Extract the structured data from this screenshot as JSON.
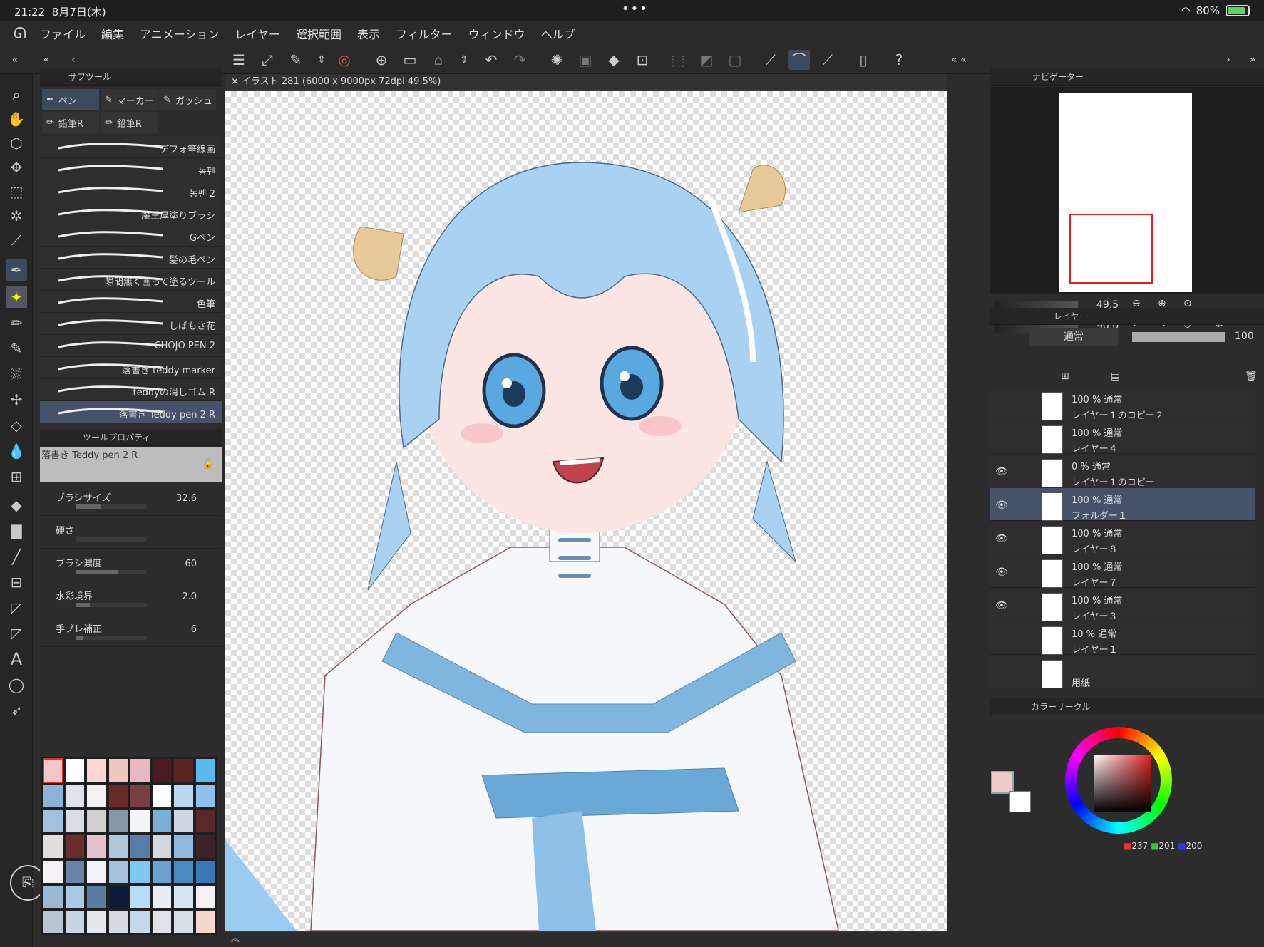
{
  "status": {
    "time": "21:22",
    "date": "8月7日(木)",
    "dots": "•••",
    "battery": "80%"
  },
  "menu": [
    "ファイル",
    "編集",
    "アニメーション",
    "レイヤー",
    "選択範囲",
    "表示",
    "フィルター",
    "ウィンドウ",
    "ヘルプ"
  ],
  "subtool": {
    "header": "サブツール",
    "tabs": [
      {
        "label": "ペン",
        "active": true
      },
      {
        "label": "マーカー",
        "active": false
      },
      {
        "label": "ガッシュ",
        "active": false
      },
      {
        "label": "鉛筆R",
        "active": false
      },
      {
        "label": "鉛筆R",
        "active": false
      }
    ],
    "brushes": [
      "デフォ筆線画",
      "농펜",
      "농펜 2",
      "魔王厚塗りブラシ",
      "Gペン",
      "髪の毛ペン",
      "隙間無く囲って塗るツール",
      "色筆",
      "しばもさ花",
      "CHOJO PEN 2",
      "落書き teddy marker",
      "teddyの消しゴム R",
      "落書き Teddy pen 2 R"
    ],
    "active_index": 12
  },
  "toolprop": {
    "header": "ツールプロパティ",
    "brush_name": "落書き Teddy pen 2 R",
    "rows": [
      {
        "label": "ブラシサイズ",
        "value": "32.6",
        "fill": 0.35
      },
      {
        "label": "硬さ",
        "value": "",
        "fill": 0
      },
      {
        "label": "ブラシ濃度",
        "value": "60",
        "fill": 0.6
      },
      {
        "label": "水彩境界",
        "value": "2.0",
        "fill": 0.2
      },
      {
        "label": "手ブレ補正",
        "value": "6",
        "fill": 0.1
      }
    ]
  },
  "palette": [
    "#f4c6c8",
    "#ffffff",
    "#fbd6d2",
    "#f0c4c0",
    "#e7b7c2",
    "#4a1c22",
    "#5a2420",
    "#5ab8f0",
    "#8db4d8",
    "#e0e4ea",
    "#f2f0f0",
    "#6a2a2a",
    "#7a4040",
    "#ffffff",
    "#bcd8f0",
    "#8ec0ec",
    "#9ec2e0",
    "#d8dce4",
    "#cfcfcf",
    "#8898a8",
    "#f2f4f6",
    "#7ab0d8",
    "#cfd8e2",
    "#5a2828",
    "#e0dce0",
    "#6a3030",
    "#e4c0cc",
    "#b0c8dc",
    "#5a7ea8",
    "#d0d8e0",
    "#8fb8dc",
    "#3a2428",
    "#f4f2f4",
    "#6a84a8",
    "#f0f2f6",
    "#a0c0dc",
    "#7ec8f0",
    "#6ca0d0",
    "#4a88c0",
    "#3a78b8",
    "#9ab8d4",
    "#a8c8e4",
    "#5c7ca0",
    "#0c1c38",
    "#b8dcf8",
    "#e8eef4",
    "#d4e4f0",
    "#f4f0f4",
    "#b8c4d0",
    "#c8d4e0",
    "#e4e8ec",
    "#d4dae0",
    "#c4d8ea",
    "#e0e4ea",
    "#d6dee6",
    "#f8d6d0"
  ],
  "document": {
    "title": "イラスト 281 (6000 x 9000px 72dpi 49.5%)"
  },
  "navigator": {
    "header": "ナビゲーター",
    "zoom": "49.5",
    "rotate": "90.0"
  },
  "layers": {
    "header": "レイヤー",
    "blend": "通常",
    "opacity": "100",
    "items": [
      {
        "pct": "100 % 通常",
        "name": "レイヤー１のコピー２",
        "visible": false,
        "active": false
      },
      {
        "pct": "100 % 通常",
        "name": "レイヤー４",
        "visible": false,
        "active": false
      },
      {
        "pct": "0 % 通常",
        "name": "レイヤー１のコピー",
        "visible": true,
        "active": false
      },
      {
        "pct": "100 % 通常",
        "name": "フォルダー１",
        "visible": true,
        "active": true
      },
      {
        "pct": "100 % 通常",
        "name": "レイヤー８",
        "visible": true,
        "active": false
      },
      {
        "pct": "100 % 通常",
        "name": "レイヤー７",
        "visible": true,
        "active": false
      },
      {
        "pct": "100 % 通常",
        "name": "レイヤー３",
        "visible": true,
        "active": false
      },
      {
        "pct": "10 % 通常",
        "name": "レイヤー１",
        "visible": false,
        "active": false
      },
      {
        "pct": "",
        "name": "用紙",
        "visible": false,
        "active": false
      }
    ]
  },
  "colorcircle": {
    "header": "カラーサークル",
    "r": "237",
    "g": "201",
    "b": "200",
    "main": "#edc9c8",
    "sub": "#ffffff"
  }
}
